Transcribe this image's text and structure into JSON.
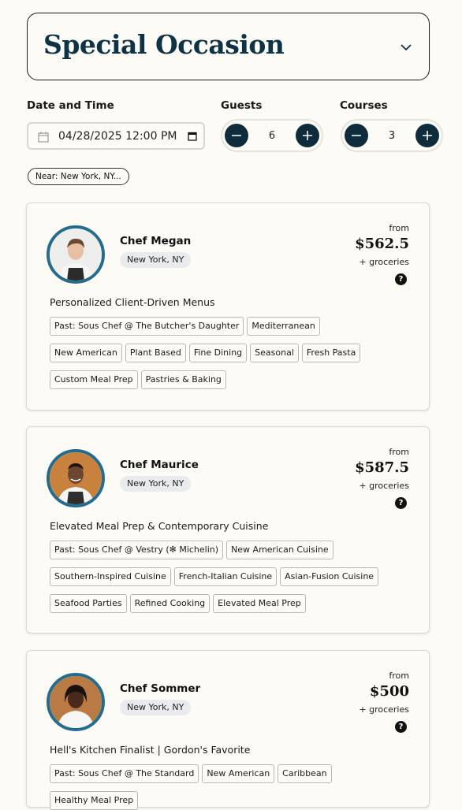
{
  "occasion": {
    "title": "Special Occasion"
  },
  "filters": {
    "date_label": "Date and Time",
    "date_value": "04/28/2025 12:00 PM",
    "guests_label": "Guests",
    "guests_value": "6",
    "courses_label": "Courses",
    "courses_value": "3",
    "near_label": "Near: New York, NY..."
  },
  "chefs": [
    {
      "name": "Chef Megan",
      "location": "New York, NY",
      "from": "from",
      "price": "$562.5",
      "groceries": "+ groceries",
      "help": "?",
      "tagline": "Personalized Client-Driven Menus",
      "tags": [
        "Past: Sous Chef @ The Butcher's Daughter",
        "Mediterranean",
        "New American",
        "Plant Based",
        "Fine Dining",
        "Seasonal",
        "Fresh Pasta",
        "Custom Meal Prep",
        "Pastries & Baking"
      ]
    },
    {
      "name": "Chef Maurice",
      "location": "New York, NY",
      "from": "from",
      "price": "$587.5",
      "groceries": "+ groceries",
      "help": "?",
      "tagline": "Elevated Meal Prep & Contemporary Cuisine",
      "tags": [
        "Past: Sous Chef @ Vestry (✻ Michelin)",
        "New American Cuisine",
        "Southern-Inspired Cuisine",
        "French-Italian Cuisine",
        "Asian-Fusion Cuisine",
        "Seafood Parties",
        "Refined Cooking",
        "Elevated Meal Prep"
      ]
    },
    {
      "name": "Chef Sommer",
      "location": "New York, NY",
      "from": "from",
      "price": "$500",
      "groceries": "+ groceries",
      "help": "?",
      "tagline": "Hell's Kitchen Finalist | Gordon's Favorite",
      "tags": [
        "Past: Sous Chef @ The Standard",
        "New American",
        "Caribbean",
        "Healthy Meal Prep"
      ]
    }
  ],
  "colors": {
    "navy": "#0f3346",
    "ring": "#236c8e",
    "button": "#0f2c3d"
  }
}
